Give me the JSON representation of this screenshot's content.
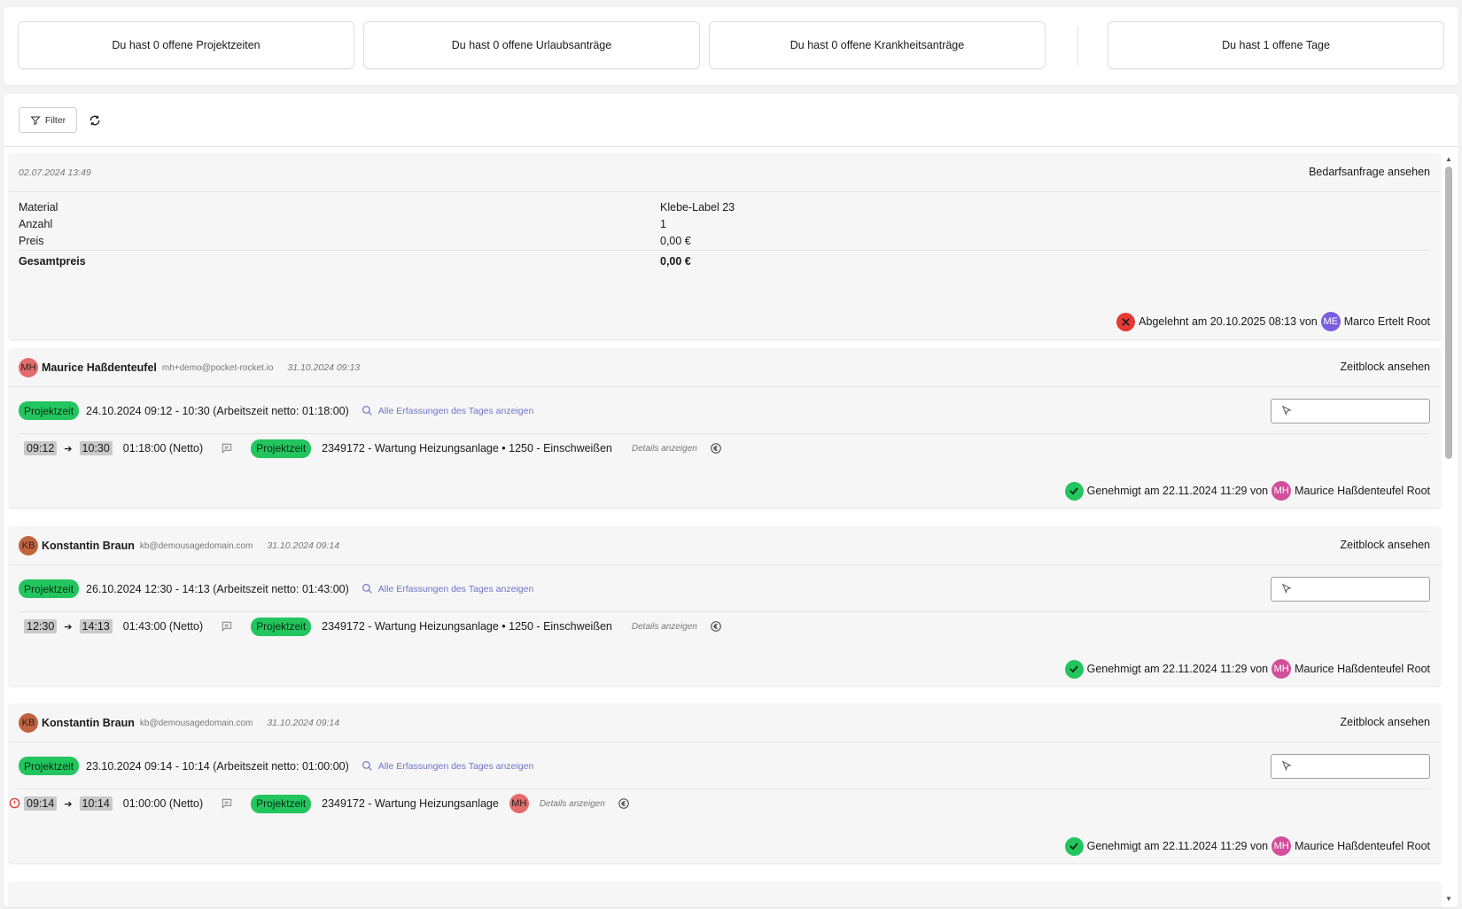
{
  "stats": [
    "Du hast 0 offene Projektzeiten",
    "Du hast 0 offene Urlaubsanträge",
    "Du hast 0 offene Krankheitsanträge",
    "Du hast 1 offene Tage"
  ],
  "toolbar": {
    "filter_label": "Filter"
  },
  "cards": {
    "request": {
      "timestamp": "02.07.2024 13:49",
      "view_link": "Bedarfsanfrage ansehen",
      "rows": [
        {
          "label": "Material",
          "value": "Klebe-Label 23"
        },
        {
          "label": "Anzahl",
          "value": "1"
        },
        {
          "label": "Preis",
          "value": "0,00 €"
        }
      ],
      "total_label": "Gesamtpreis",
      "total_value": "0,00 €",
      "status_text": "Abgelehnt am 20.10.2025 08:13 von",
      "status_avatar": "ME",
      "status_user": "Marco Ertelt Root"
    },
    "block1": {
      "avatar": "MH",
      "name": "Maurice Haßdenteufel",
      "email": "mh+demo@pocket-rocket.io",
      "timestamp": "31.10.2024 09:13",
      "view_link": "Zeitblock ansehen",
      "badge": "Projektzeit",
      "entry_text": "24.10.2024 09:12 - 10:30 (Arbeitszeit netto: 01:18:00)",
      "day_link": "Alle Erfassungen des Tages anzeigen",
      "start": "09:12",
      "end": "10:30",
      "netto": "01:18:00 (Netto)",
      "project": "2349172 - Wartung Heizungsanlage • 1250 - Einschweißen",
      "details_link": "Details anzeigen",
      "status_text": "Genehmigt am 22.11.2024 11:29 von",
      "status_avatar": "MH",
      "status_user": "Maurice Haßdenteufel Root"
    },
    "block2": {
      "avatar": "KB",
      "name": "Konstantin Braun",
      "email": "kb@demousagedomain.com",
      "timestamp": "31.10.2024 09:14",
      "view_link": "Zeitblock ansehen",
      "badge": "Projektzeit",
      "entry_text": "26.10.2024 12:30 - 14:13 (Arbeitszeit netto: 01:43:00)",
      "day_link": "Alle Erfassungen des Tages anzeigen",
      "start": "12:30",
      "end": "14:13",
      "netto": "01:43:00 (Netto)",
      "project": "2349172 - Wartung Heizungsanlage • 1250 - Einschweißen",
      "details_link": "Details anzeigen",
      "status_text": "Genehmigt am 22.11.2024 11:29 von",
      "status_avatar": "MH",
      "status_user": "Maurice Haßdenteufel Root"
    },
    "block3": {
      "avatar": "KB",
      "name": "Konstantin Braun",
      "email": "kb@demousagedomain.com",
      "timestamp": "31.10.2024 09:14",
      "view_link": "Zeitblock ansehen",
      "badge": "Projektzeit",
      "entry_text": "23.10.2024 09:14 - 10:14 (Arbeitszeit netto: 01:00:00)",
      "day_link": "Alle Erfassungen des Tages anzeigen",
      "start": "09:14",
      "end": "10:14",
      "netto": "01:00:00 (Netto)",
      "project": "2349172 - Wartung Heizungsanlage",
      "project_avatar": "MH",
      "details_link": "Details anzeigen",
      "status_text": "Genehmigt am 22.11.2024 11:29 von",
      "status_avatar": "MH",
      "status_user": "Maurice Haßdenteufel Root"
    }
  },
  "colors": {
    "badge_green": "#22c55e",
    "reject_red": "#e53935",
    "link_purple": "#6f74c9"
  }
}
